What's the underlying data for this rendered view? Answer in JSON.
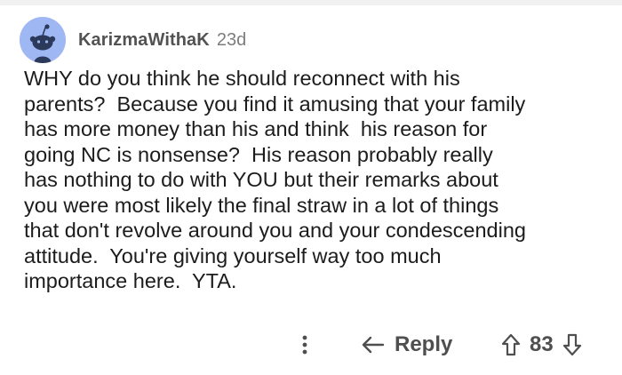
{
  "comment": {
    "author": "KarizmaWithaK",
    "age": "23d",
    "body": "WHY do you think he should reconnect with his\nparents?  Because you find it amusing that your family\nhas more money than his and think  his reason for\ngoing NC is nonsense?  His reason probably really\nhas nothing to do with YOU but their remarks about\nyou were most likely the final straw in a lot of things\nthat don't revolve around you and your condescending\nattitude.  You're giving yourself way too much\nimportance here.  YTA."
  },
  "actions": {
    "reply_label": "Reply",
    "vote_count": "83"
  },
  "icons": {
    "avatar": "snoo-avatar-icon",
    "more": "more-options-icon",
    "reply": "reply-arrow-icon",
    "upvote": "upvote-arrow-icon",
    "downvote": "downvote-arrow-icon"
  },
  "colors": {
    "avatar_bg": "#9fb8f4",
    "text": "#1c1c1c",
    "meta": "#7c7c7c",
    "icon": "#4f4f4f"
  }
}
